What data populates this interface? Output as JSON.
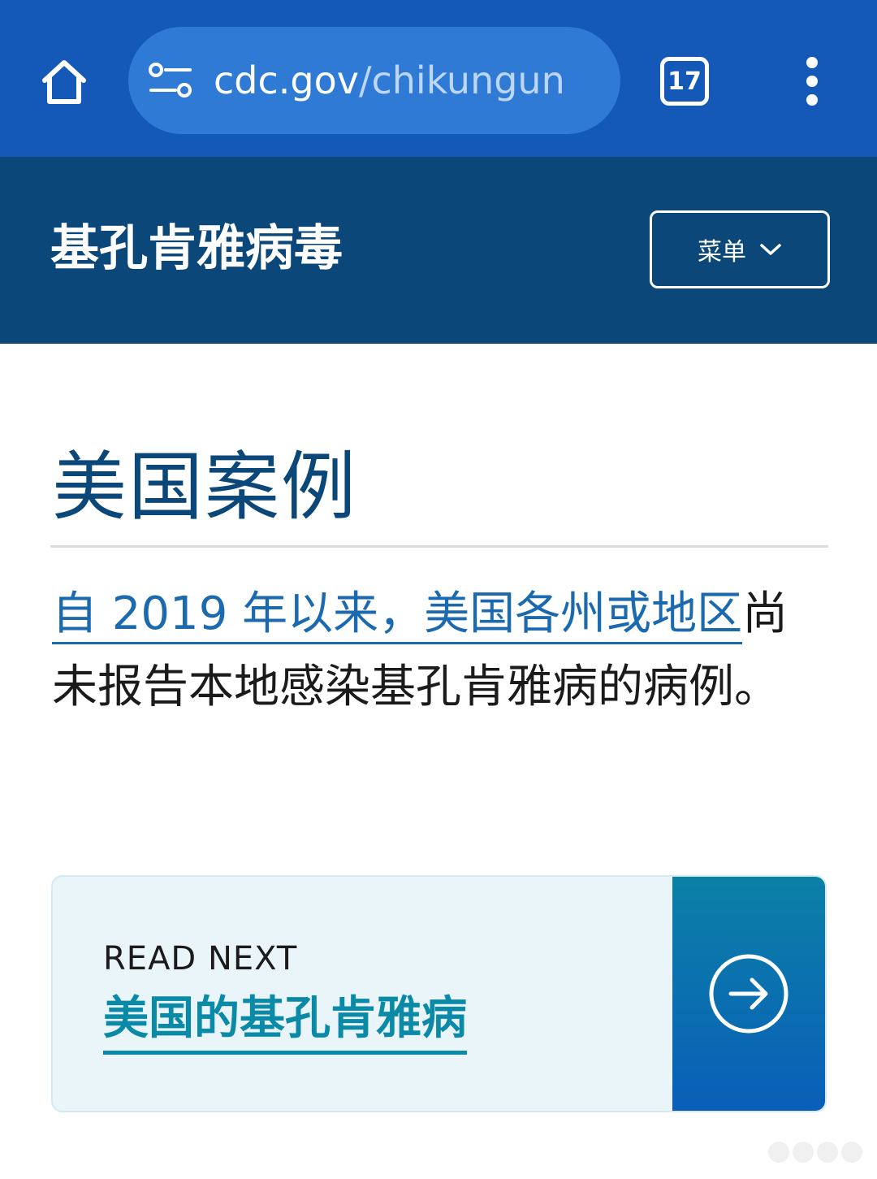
{
  "browser": {
    "url_domain": "cdc.gov",
    "url_path": "/chikungun",
    "tab_count": "17",
    "theme_color": "#1559b8"
  },
  "site": {
    "title": "基孔肯雅病毒",
    "menu_label": "菜单",
    "header_color": "#0b4778"
  },
  "main": {
    "heading": "美国案例",
    "intro_link": "自 2019 年以来，美国各州或地区",
    "intro_rest": "尚未报告本地感染基孔肯雅病的病例。"
  },
  "read_next": {
    "eyebrow": "READ NEXT",
    "link_text": "美国的基孔肯雅病"
  },
  "icons": [
    "home-icon",
    "site-settings-icon",
    "tabs-icon",
    "more-menu-icon",
    "chevron-down-icon",
    "arrow-right-circle-icon"
  ]
}
